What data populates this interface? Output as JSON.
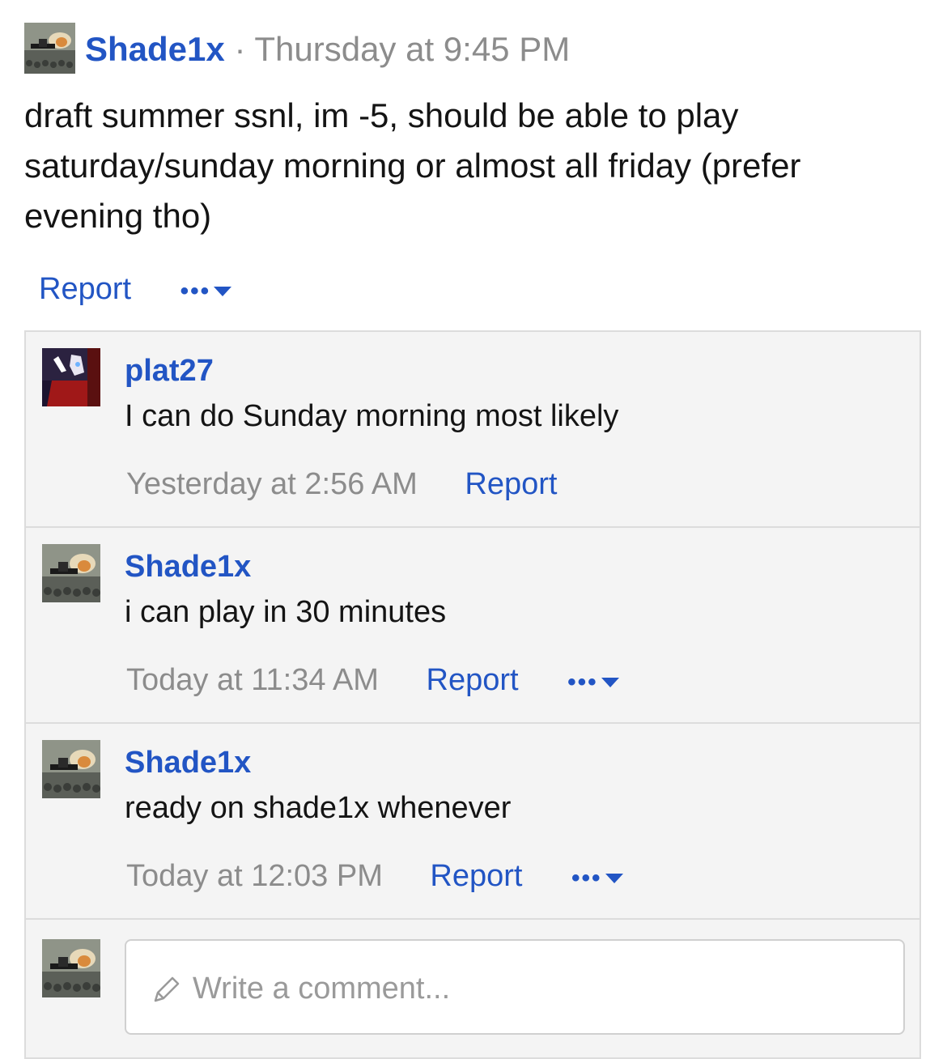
{
  "post": {
    "author": "Shade1x",
    "separator": "·",
    "timestamp": "Thursday at 9:45 PM",
    "body": "draft summer ssnl, im -5, should be able to play saturday/sunday morning or almost all friday (prefer evening tho)",
    "report_label": "Report",
    "more_label": "•••"
  },
  "comments": [
    {
      "author": "plat27",
      "text": "I can do Sunday morning most likely",
      "timestamp": "Yesterday at 2:56 AM",
      "report_label": "Report"
    },
    {
      "author": "Shade1x",
      "text": "i can play in 30 minutes",
      "timestamp": "Today at 11:34 AM",
      "report_label": "Report",
      "more_label": "•••"
    },
    {
      "author": "Shade1x",
      "text": "ready on shade1x whenever",
      "timestamp": "Today at 12:03 PM",
      "report_label": "Report",
      "more_label": "•••"
    }
  ],
  "composer": {
    "placeholder": "Write a comment..."
  },
  "colors": {
    "link": "#2255c4",
    "muted": "#8c8c8c",
    "panel": "#f4f4f4",
    "border": "#dcdcdc"
  },
  "icons": {
    "composer": "pencil-icon",
    "more": "chevron-down-icon"
  }
}
